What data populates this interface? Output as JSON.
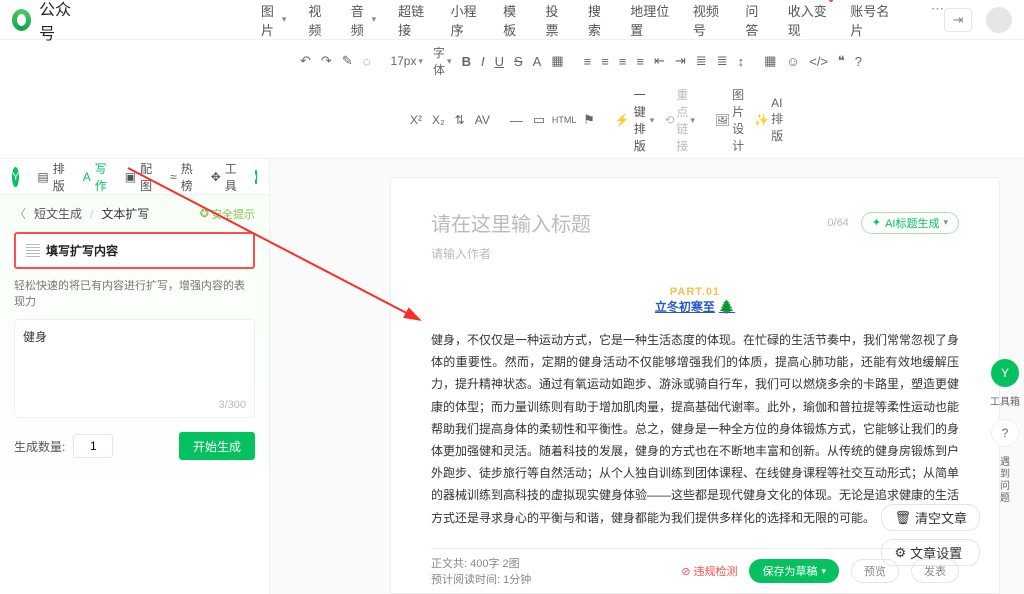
{
  "brand": "公众号",
  "top_nav": [
    "图片",
    "视频",
    "音频",
    "超链接",
    "小程序",
    "模板",
    "投票",
    "搜索",
    "地理位置",
    "视频号",
    "问答",
    "收入变现",
    "账号名片"
  ],
  "toolbar1": {
    "undo": "↶",
    "redo": "↷",
    "brush": "✎",
    "clear": "◌",
    "font_size": "17px",
    "font_family": "字体",
    "bold": "B",
    "italic": "I",
    "underline": "U",
    "strike": "S",
    "color": "A",
    "bg": "▦"
  },
  "toolbar2": {
    "sup": "X²",
    "sub": "X₂",
    "lh": "⇅",
    "ls": "AV",
    "one_click": "一键排版",
    "reset_link": "重点链接",
    "img_design": "图片设计",
    "ai_layout": "AI排版"
  },
  "left_tabs": {
    "typeset": "排版",
    "write": "写作",
    "image": "配图",
    "hot": "热榜",
    "tools": "工具"
  },
  "breadcrumb": {
    "back": "短文生成",
    "current": "文本扩写",
    "safe": "安全提示"
  },
  "input_box": {
    "label": "填写扩写内容",
    "desc": "轻松快速的将已有内容进行扩写，增强内容的表现力",
    "value": "健身",
    "counter": "3/300"
  },
  "gen": {
    "count_label": "生成数量:",
    "count": "1",
    "btn": "开始生成"
  },
  "editor": {
    "title_ph": "请在这里输入标题",
    "title_count": "0/64",
    "ai_title": "AI标题生成",
    "author_ph": "请输入作者",
    "part_num": "PART.01",
    "part_title": "立冬初寒至",
    "body": "健身，不仅仅是一种运动方式，它是一种生活态度的体现。在忙碌的生活节奏中，我们常常忽视了身体的重要性。然而，定期的健身活动不仅能够增强我们的体质，提高心肺功能，还能有效地缓解压力，提升精神状态。通过有氧运动如跑步、游泳或骑自行车，我们可以燃烧多余的卡路里，塑造更健康的体型；而力量训练则有助于增加肌肉量，提高基础代谢率。此外，瑜伽和普拉提等柔性运动也能帮助我们提高身体的柔韧性和平衡性。总之，健身是一种全方位的身体锻炼方式，它能够让我们的身体更加强健和灵活。随着科技的发展，健身的方式也在不断地丰富和创新。从传统的健身房锻炼到户外跑步、徒步旅行等自然活动；从个人独自训练到团体课程、在线健身课程等社交互动形式；从简单的器械训练到高科技的虚拟现实健身体验——这些都是现代健身文化的体现。无论是追求健康的生活方式还是寻求身心的平衡与和谐，健身都能为我们提供多样化的选择和无限的可能。"
  },
  "footer": {
    "meta1_label": "正文共:",
    "meta1_val": "400字 2图",
    "meta2_label": "预计阅读时间:",
    "meta2_val": "1分钟",
    "violate": "违规检测",
    "save": "保存为草稿",
    "preview": "预览",
    "publish": "发表"
  },
  "float": {
    "clear": "清空文章",
    "settings": "文章设置"
  },
  "rail": {
    "toolbox": "工具箱",
    "faq": "遇到问题"
  }
}
